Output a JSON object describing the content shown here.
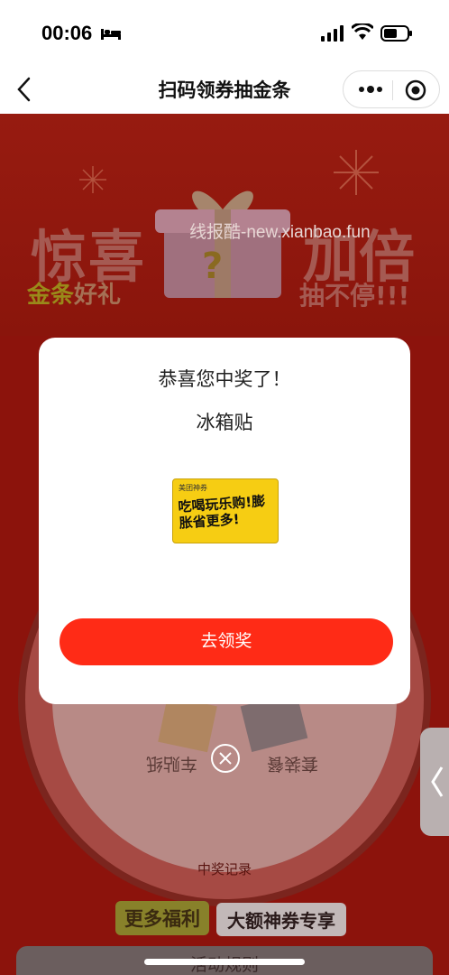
{
  "status_bar": {
    "time": "00:06",
    "icons": [
      "bed-icon",
      "signal-icon",
      "wifi-icon",
      "battery-icon"
    ]
  },
  "nav": {
    "title": "扫码领券抽金条",
    "back_icon": "chevron-left-icon",
    "more_icon": "more-dots-icon",
    "close_icon": "target-icon"
  },
  "banner": {
    "left_big": "惊喜",
    "left_small_gold": "金条",
    "left_small_rest": "好礼",
    "right_big": "加倍",
    "right_small": "抽不停!!!",
    "watermark": "线报酷-new.xianbao.fun"
  },
  "wheel": {
    "labels": [
      "车贴纸",
      "套装餐"
    ]
  },
  "page": {
    "records_link": "中奖记录",
    "more_benefits": "更多福利",
    "big_coupon": "大额神券专享",
    "rules": "活动规则"
  },
  "modal": {
    "title": "恭喜您中奖了！",
    "prize_name": "冰箱贴",
    "prize_image_small": "美团神券",
    "prize_image_text": "吃喝玩乐购!膨胀省更多!",
    "claim_button": "去领奖"
  },
  "colors": {
    "accent": "#ff2b16",
    "page_dim_bg": "#8c130c",
    "prize_yellow": "#f6cd13"
  }
}
